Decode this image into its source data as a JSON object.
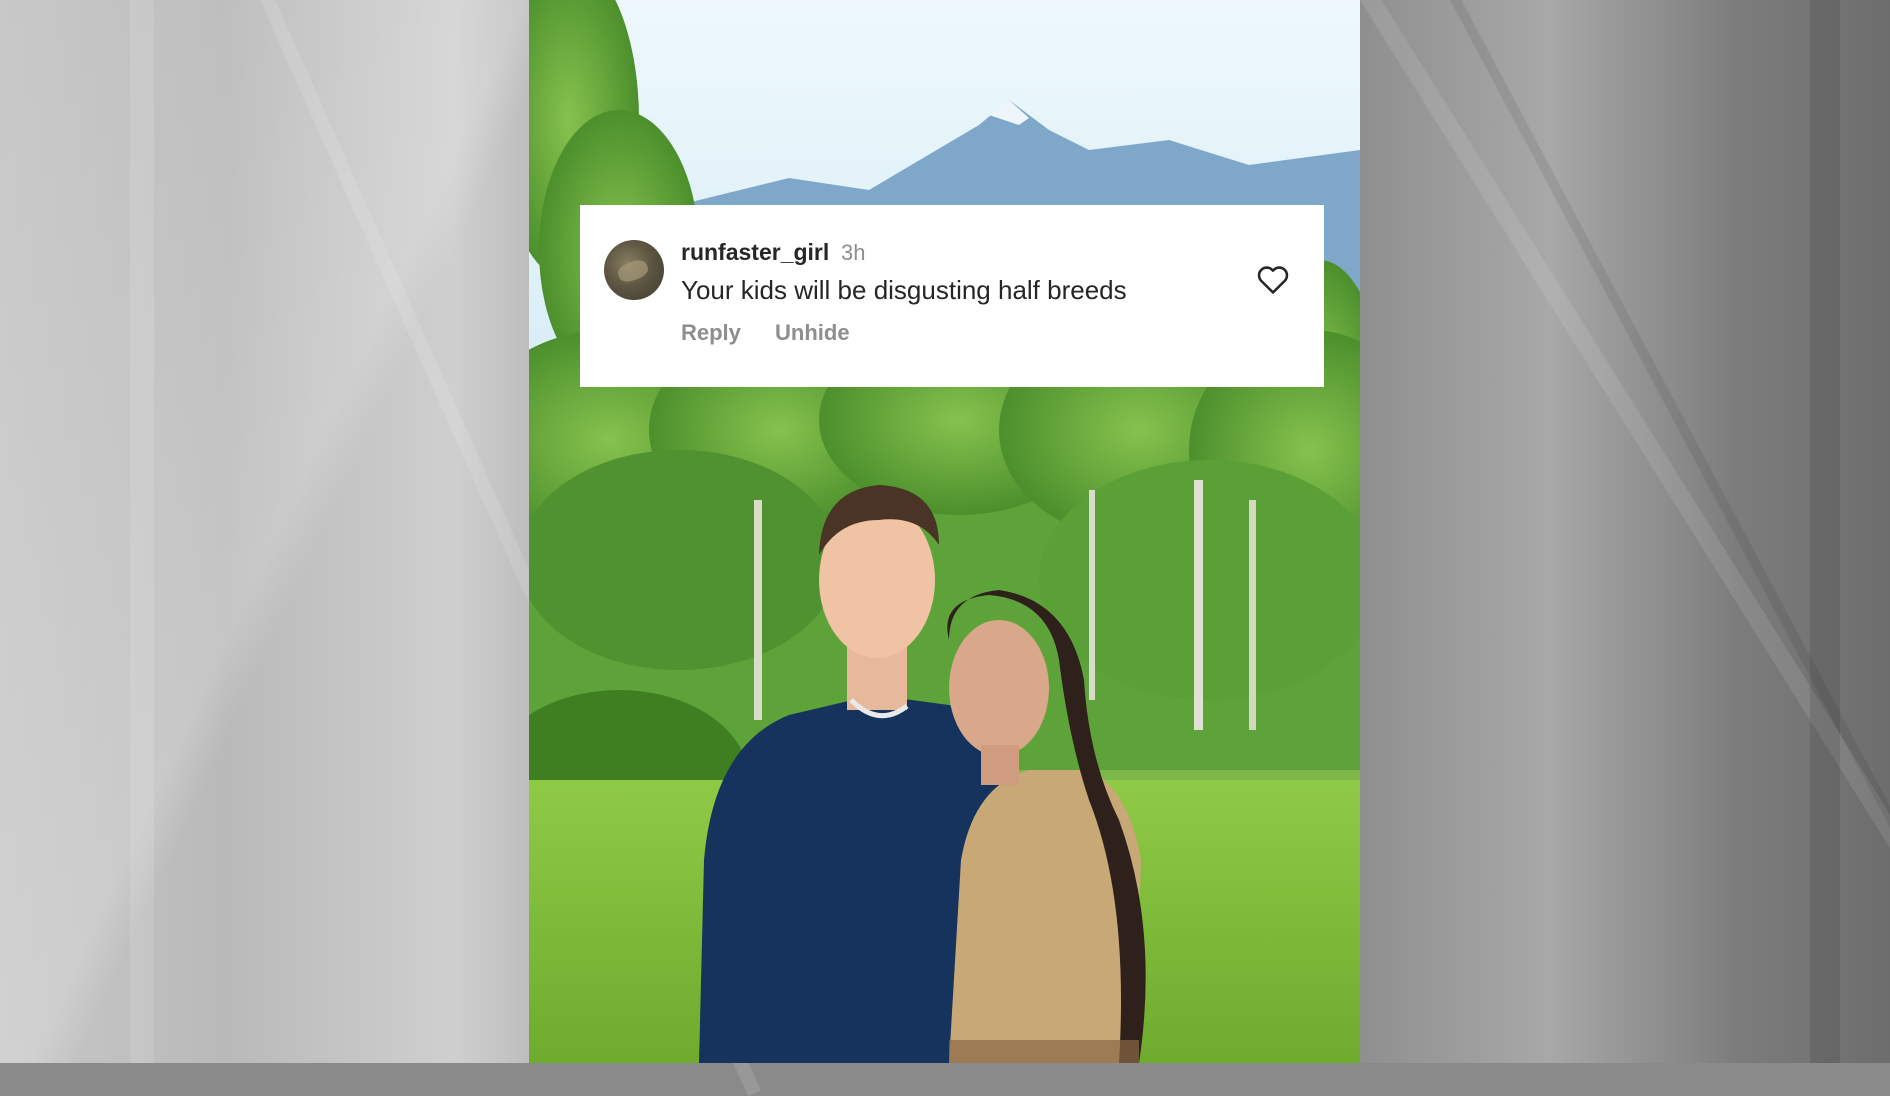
{
  "comment": {
    "username": "runfaster_girl",
    "timestamp": "3h",
    "text": "Your kids will be disgusting half breeds",
    "reply_label": "Reply",
    "unhide_label": "Unhide",
    "like_icon": "heart-outline-icon",
    "avatar_icon": "user-avatar"
  },
  "photo": {
    "description_colors": {
      "sky": "#dff0f8",
      "mountains": "#7ea6c8",
      "trees": "#5fa83a",
      "grass": "#8cc843",
      "shirt_man": "#15325c",
      "shirt_woman": "#c9a878"
    }
  },
  "colors": {
    "card_bg": "#ffffff",
    "username": "#262626",
    "secondary_text": "#8e8e8e"
  }
}
